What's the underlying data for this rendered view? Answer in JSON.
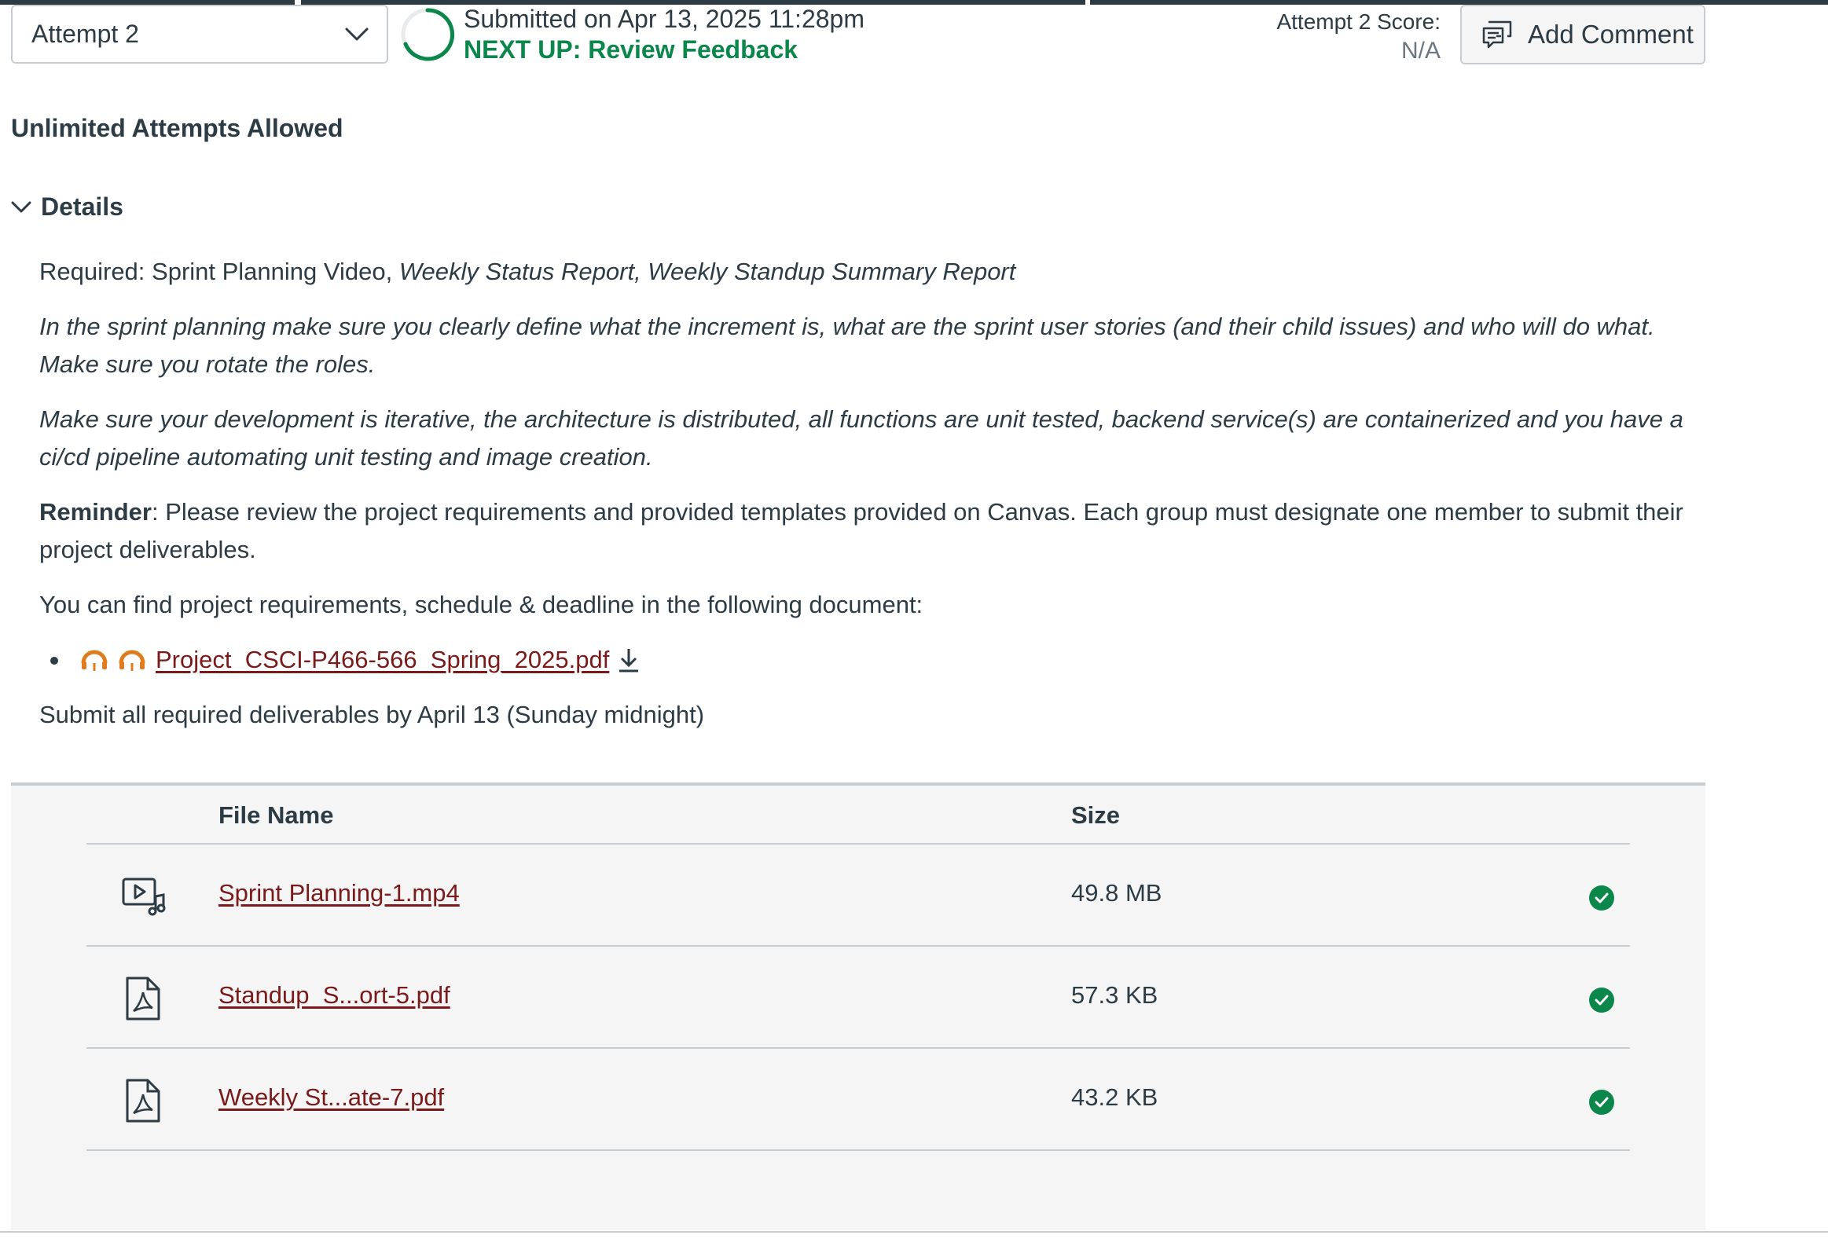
{
  "header": {
    "attempt_select_value": "Attempt 2",
    "submitted_on": "Submitted on Apr 13, 2025 11:28pm",
    "next_up": "NEXT UP: Review Feedback",
    "score_label": "Attempt 2 Score:",
    "score_value": "N/A",
    "add_comment_label": "Add Comment"
  },
  "attempts_note": "Unlimited Attempts Allowed",
  "details": {
    "toggle_label": "Details",
    "required_prefix": "Required: Sprint Planning Video, ",
    "required_italic": "Weekly Status Report, Weekly Standup Summary Report",
    "paragraph_sprint": "In the sprint planning make sure you clearly define what the increment is, what are the sprint user stories (and their child issues) and who will do what. Make sure you rotate the roles.",
    "paragraph_dev": "Make sure your development is iterative, the architecture is distributed, all functions are unit tested, backend service(s) are containerized and you have a ci/cd pipeline automating unit testing and image creation.",
    "reminder_bold": "Reminder",
    "reminder_text": ": Please review the project requirements and provided templates provided on Canvas. Each group must designate one member to submit their project deliverables.",
    "find_text": "You can find project requirements, schedule & deadline in the following document:",
    "document_link": "Project_CSCI-P466-566_Spring_2025.pdf",
    "deadline_text": "Submit all required deliverables by April 13 (Sunday midnight)"
  },
  "files": {
    "headers": {
      "name": "File Name",
      "size": "Size"
    },
    "rows": [
      {
        "icon": "video-audio-icon",
        "name": "Sprint Planning-1.mp4",
        "size": "49.8 MB",
        "status": "uploaded"
      },
      {
        "icon": "pdf-icon",
        "name": "Standup_S...ort-5.pdf",
        "size": "57.3 KB",
        "status": "uploaded"
      },
      {
        "icon": "pdf-icon",
        "name": "Weekly St...ate-7.pdf",
        "size": "43.2 KB",
        "status": "uploaded"
      }
    ]
  },
  "colors": {
    "text": "#2d3b45",
    "success": "#0b874b",
    "link": "#7a1a1a",
    "border": "#c7cdd1",
    "panel_bg": "#f5f5f5",
    "icon_orange": "#e07c1f"
  }
}
